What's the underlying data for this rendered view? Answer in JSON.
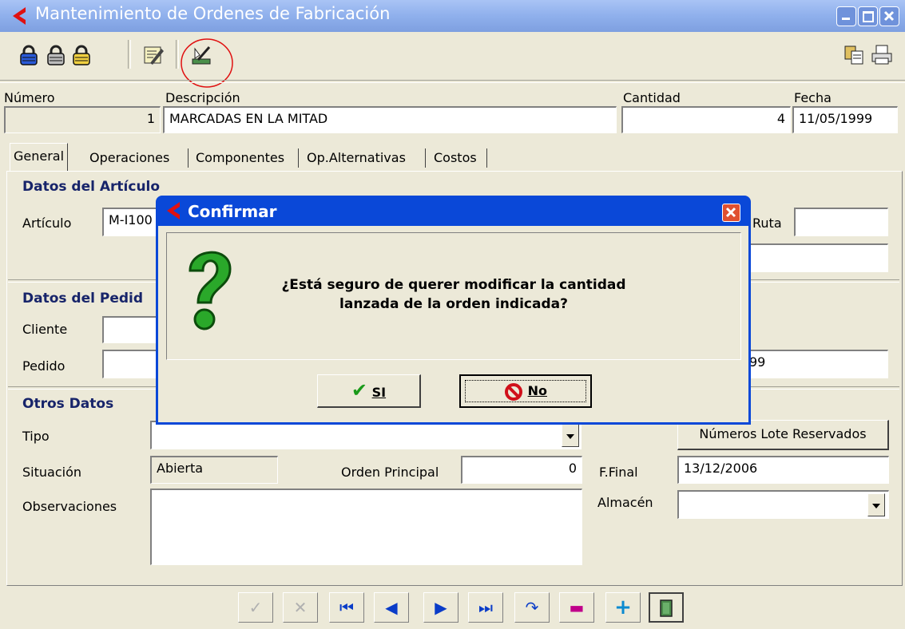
{
  "window": {
    "title": "Mantenimiento de Ordenes de Fabricación"
  },
  "header": {
    "numero_label": "Número",
    "numero_value": "1",
    "descripcion_label": "Descripción",
    "descripcion_value": "MARCADAS EN LA MITAD",
    "cantidad_label": "Cantidad",
    "cantidad_value": "4",
    "fecha_label": "Fecha",
    "fecha_value": "11/05/1999"
  },
  "tabs": [
    "General",
    "Operaciones",
    "Componentes",
    "Op.Alternativas",
    "Costos"
  ],
  "articulo": {
    "section": "Datos del Artículo",
    "articulo_label": "Artículo",
    "articulo_value": "M-I100",
    "ruta_label": "Ruta"
  },
  "pedido": {
    "section": "Datos del Pedid",
    "cliente_label": "Cliente",
    "pedido_label": "Pedido",
    "partial_date": "99"
  },
  "otros": {
    "section": "Otros Datos",
    "tipo_label": "Tipo",
    "situacion_label": "Situación",
    "situacion_value": "Abierta",
    "orden_label": "Orden Principal",
    "orden_value": "0",
    "ffinal_label": "F.Final",
    "ffinal_value": "13/12/2006",
    "observaciones_label": "Observaciones",
    "almacen_label": "Almacén",
    "lotes_button": "Números Lote Reservados"
  },
  "dialog": {
    "title": "Confirmar",
    "message_line1": "¿Está seguro de querer modificar la cantidad",
    "message_line2": "lanzada de la orden indicada?",
    "yes_label": "SI",
    "no_label": "No"
  },
  "colors": {
    "titlebar": "#8fb0ec",
    "dialog_frame": "#0a48d8",
    "accent_red": "#d0201a"
  }
}
